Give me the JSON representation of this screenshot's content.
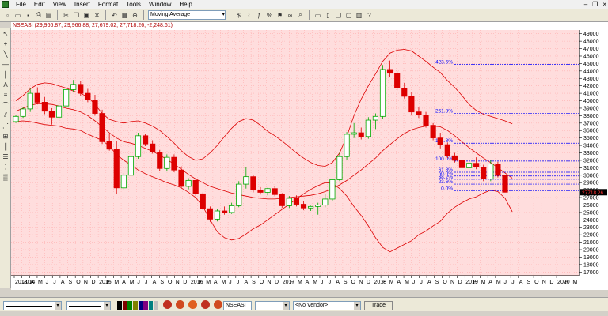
{
  "menu": [
    "File",
    "Edit",
    "View",
    "Insert",
    "Format",
    "Tools",
    "Window",
    "Help"
  ],
  "toolbar": {
    "indicator_select": "Moving Average"
  },
  "chart_title": "NSEASI (29,966.87, 29,966.88, 27,679.02, 27,718.26, -2,248.61)",
  "price_tag": "27718.26",
  "bottom": {
    "symbol": "NSEASI",
    "vendor": "<No Vendor>",
    "trade_label": "Trade"
  },
  "colors": {
    "up": "#00aa00",
    "down": "#dd0000",
    "band": "#dd0000",
    "fib": "#0000ff",
    "bg": "#ffdddd",
    "grid": "#ffb0b0"
  },
  "chart_data": {
    "type": "candlestick",
    "title": "NSEASI (29,966.87, 29,966.88, 27,679.02, 27,718.26, -2,248.61)",
    "y_ticks": [
      49000,
      48000,
      47000,
      46000,
      45000,
      44000,
      43000,
      42000,
      41000,
      40000,
      39000,
      38000,
      37000,
      36000,
      35000,
      34000,
      33000,
      32000,
      31000,
      30000,
      29000,
      28000,
      27000,
      26000,
      25000,
      24000,
      23000,
      22000,
      21000,
      20000,
      19000,
      18000,
      17000
    ],
    "ylim": [
      16500,
      49500
    ],
    "x_labels": [
      "2013",
      "2014",
      "A",
      "M",
      "J",
      "J",
      "A",
      "S",
      "O",
      "N",
      "D",
      "2015",
      "F",
      "M",
      "A",
      "M",
      "J",
      "J",
      "A",
      "S",
      "O",
      "N",
      "D",
      "2016",
      "F",
      "M",
      "A",
      "M",
      "J",
      "J",
      "A",
      "S",
      "O",
      "N",
      "D",
      "2017",
      "F",
      "M",
      "A",
      "M",
      "J",
      "J",
      "A",
      "S",
      "O",
      "N",
      "D",
      "2018",
      "F",
      "M",
      "A",
      "M",
      "J",
      "J",
      "A",
      "S",
      "O",
      "N",
      "D",
      "2019",
      "F",
      "M",
      "A",
      "M",
      "J",
      "J",
      "A",
      "S",
      "O",
      "N",
      "D",
      "2020",
      "F",
      "M"
    ],
    "candles": [
      {
        "o": 37200,
        "h": 38100,
        "l": 37000,
        "c": 37900
      },
      {
        "o": 37900,
        "h": 39200,
        "l": 37700,
        "c": 38900
      },
      {
        "o": 38900,
        "h": 41600,
        "l": 38500,
        "c": 41000
      },
      {
        "o": 41000,
        "h": 41800,
        "l": 39500,
        "c": 39800
      },
      {
        "o": 39800,
        "h": 40500,
        "l": 38200,
        "c": 38600
      },
      {
        "o": 38600,
        "h": 39000,
        "l": 36800,
        "c": 37800
      },
      {
        "o": 37800,
        "h": 39600,
        "l": 37500,
        "c": 39300
      },
      {
        "o": 39300,
        "h": 41900,
        "l": 39000,
        "c": 41500
      },
      {
        "o": 41500,
        "h": 42800,
        "l": 41200,
        "c": 42200
      },
      {
        "o": 42200,
        "h": 42700,
        "l": 40600,
        "c": 41000
      },
      {
        "o": 41000,
        "h": 41600,
        "l": 39800,
        "c": 40100
      },
      {
        "o": 40100,
        "h": 40800,
        "l": 38000,
        "c": 38300
      },
      {
        "o": 38300,
        "h": 38800,
        "l": 34200,
        "c": 34500
      },
      {
        "o": 34500,
        "h": 35500,
        "l": 33300,
        "c": 33500
      },
      {
        "o": 33500,
        "h": 34600,
        "l": 27500,
        "c": 28300
      },
      {
        "o": 28300,
        "h": 30300,
        "l": 28000,
        "c": 30000
      },
      {
        "o": 30000,
        "h": 33000,
        "l": 29500,
        "c": 32500
      },
      {
        "o": 32500,
        "h": 35700,
        "l": 32200,
        "c": 35300
      },
      {
        "o": 35300,
        "h": 35600,
        "l": 33900,
        "c": 34200
      },
      {
        "o": 34200,
        "h": 34700,
        "l": 32900,
        "c": 33100
      },
      {
        "o": 33100,
        "h": 33400,
        "l": 30600,
        "c": 30900
      },
      {
        "o": 30900,
        "h": 32800,
        "l": 30500,
        "c": 32400
      },
      {
        "o": 32400,
        "h": 32800,
        "l": 30400,
        "c": 30700
      },
      {
        "o": 30700,
        "h": 31200,
        "l": 28200,
        "c": 28500
      },
      {
        "o": 28500,
        "h": 29600,
        "l": 28100,
        "c": 29300
      },
      {
        "o": 29300,
        "h": 29600,
        "l": 27200,
        "c": 27500
      },
      {
        "o": 27500,
        "h": 27700,
        "l": 25300,
        "c": 25500
      },
      {
        "o": 25500,
        "h": 25800,
        "l": 23700,
        "c": 24100
      },
      {
        "o": 24100,
        "h": 25500,
        "l": 23800,
        "c": 25200
      },
      {
        "o": 25200,
        "h": 25800,
        "l": 24700,
        "c": 25000
      },
      {
        "o": 25000,
        "h": 26300,
        "l": 24800,
        "c": 25900
      },
      {
        "o": 25900,
        "h": 29200,
        "l": 25700,
        "c": 28800
      },
      {
        "o": 28800,
        "h": 31100,
        "l": 28200,
        "c": 29800
      },
      {
        "o": 29800,
        "h": 30000,
        "l": 27700,
        "c": 28000
      },
      {
        "o": 28000,
        "h": 28400,
        "l": 27400,
        "c": 27700
      },
      {
        "o": 27700,
        "h": 28300,
        "l": 27300,
        "c": 28200
      },
      {
        "o": 28200,
        "h": 28500,
        "l": 27200,
        "c": 27400
      },
      {
        "o": 27400,
        "h": 27600,
        "l": 25600,
        "c": 25900
      },
      {
        "o": 25900,
        "h": 27200,
        "l": 25600,
        "c": 26900
      },
      {
        "o": 26900,
        "h": 27300,
        "l": 25800,
        "c": 26100
      },
      {
        "o": 26100,
        "h": 26500,
        "l": 25300,
        "c": 25600
      },
      {
        "o": 25600,
        "h": 25900,
        "l": 25200,
        "c": 25800
      },
      {
        "o": 25800,
        "h": 26300,
        "l": 24700,
        "c": 26000
      },
      {
        "o": 26000,
        "h": 27500,
        "l": 25700,
        "c": 26800
      },
      {
        "o": 26800,
        "h": 29500,
        "l": 26500,
        "c": 29400
      },
      {
        "o": 29400,
        "h": 33000,
        "l": 29200,
        "c": 32500
      },
      {
        "o": 32500,
        "h": 35800,
        "l": 32000,
        "c": 35500
      },
      {
        "o": 35500,
        "h": 37000,
        "l": 35000,
        "c": 35700
      },
      {
        "o": 35700,
        "h": 36400,
        "l": 34800,
        "c": 35200
      },
      {
        "o": 35200,
        "h": 37800,
        "l": 34900,
        "c": 37400
      },
      {
        "o": 37400,
        "h": 38300,
        "l": 36200,
        "c": 37900
      },
      {
        "o": 37900,
        "h": 44800,
        "l": 37600,
        "c": 44200
      },
      {
        "o": 44200,
        "h": 45400,
        "l": 43200,
        "c": 43700
      },
      {
        "o": 43700,
        "h": 44000,
        "l": 41400,
        "c": 41700
      },
      {
        "o": 41700,
        "h": 42400,
        "l": 40300,
        "c": 40600
      },
      {
        "o": 40600,
        "h": 41200,
        "l": 38100,
        "c": 38500
      },
      {
        "o": 38500,
        "h": 39200,
        "l": 37700,
        "c": 38100
      },
      {
        "o": 38100,
        "h": 38500,
        "l": 36400,
        "c": 36700
      },
      {
        "o": 36700,
        "h": 37000,
        "l": 34700,
        "c": 35000
      },
      {
        "o": 35000,
        "h": 35700,
        "l": 33600,
        "c": 34100
      },
      {
        "o": 34100,
        "h": 34400,
        "l": 32300,
        "c": 32600
      },
      {
        "o": 32600,
        "h": 33000,
        "l": 31700,
        "c": 32000
      },
      {
        "o": 32000,
        "h": 32300,
        "l": 30700,
        "c": 31000
      },
      {
        "o": 31000,
        "h": 32000,
        "l": 30300,
        "c": 31600
      },
      {
        "o": 31600,
        "h": 32400,
        "l": 30800,
        "c": 31100
      },
      {
        "o": 31100,
        "h": 31400,
        "l": 29200,
        "c": 29500
      },
      {
        "o": 29500,
        "h": 32000,
        "l": 29200,
        "c": 31500
      },
      {
        "o": 31500,
        "h": 31800,
        "l": 29700,
        "c": 29967
      },
      {
        "o": 29967,
        "h": 29967,
        "l": 27679,
        "c": 27718
      }
    ],
    "bb_upper": [
      40000,
      40700,
      41600,
      42200,
      42400,
      42300,
      42000,
      41700,
      41300,
      41000,
      40500,
      39500,
      38300,
      37500,
      37200,
      37000,
      37200,
      37300,
      37000,
      36600,
      36000,
      35200,
      34300,
      33300,
      32500,
      32000,
      32200,
      33000,
      34000,
      35200,
      36300,
      37200,
      37600,
      37400,
      36700,
      35900,
      35300,
      34600,
      33800,
      33000,
      32300,
      31700,
      31300,
      31200,
      31700,
      33000,
      35200,
      38000,
      40200,
      42000,
      43600,
      45300,
      46400,
      46800,
      46900,
      46700,
      46000,
      45300,
      44500,
      43800,
      42700,
      41800,
      40700,
      39500,
      38700,
      38200,
      37900,
      37600,
      37300,
      36900
    ],
    "bb_mid": [
      38600,
      39000,
      39400,
      39600,
      39600,
      39500,
      39300,
      39000,
      38800,
      38500,
      38000,
      37300,
      36500,
      35700,
      35000,
      34500,
      34300,
      34000,
      33600,
      33200,
      32700,
      32100,
      31500,
      30800,
      30100,
      29500,
      29000,
      28500,
      28200,
      27900,
      27600,
      27400,
      27200,
      27000,
      26900,
      26800,
      26800,
      26900,
      27000,
      27100,
      27200,
      27300,
      27500,
      27800,
      28200,
      28700,
      29300,
      30000,
      30700,
      31500,
      32300,
      33300,
      34100,
      34900,
      35600,
      36100,
      36400,
      36600,
      36600,
      36500,
      36000,
      35300,
      34500,
      33700,
      33000,
      32300,
      31700,
      31000,
      30300,
      29600
    ],
    "bb_lower": [
      37200,
      37300,
      37200,
      37000,
      36800,
      36700,
      36600,
      36300,
      36200,
      36000,
      35500,
      35100,
      34700,
      33900,
      32800,
      32000,
      31400,
      30700,
      30200,
      29800,
      29400,
      29000,
      28700,
      28300,
      27700,
      27000,
      25800,
      24000,
      22400,
      21600,
      21300,
      21500,
      22100,
      22800,
      23300,
      24000,
      24700,
      25400,
      26100,
      26800,
      27500,
      28100,
      28600,
      29000,
      28900,
      28200,
      27200,
      25800,
      24600,
      23200,
      21600,
      20300,
      19700,
      20200,
      20700,
      21200,
      22000,
      22500,
      23200,
      23800,
      24900,
      25700,
      26300,
      26800,
      27100,
      27600,
      28000,
      27800,
      26900,
      25100
    ],
    "fib_levels": [
      {
        "label": "423.6%",
        "value": 44900
      },
      {
        "label": "261.8%",
        "value": 38300
      },
      {
        "label": "161.8%",
        "value": 34300
      },
      {
        "label": "100.0%",
        "value": 31900
      },
      {
        "label": "61.8%",
        "value": 30400
      },
      {
        "label": "50.0%",
        "value": 29900
      },
      {
        "label": "38.2%",
        "value": 29450
      },
      {
        "label": "23.6%",
        "value": 28800
      },
      {
        "label": "0.0%",
        "value": 27900
      }
    ]
  }
}
